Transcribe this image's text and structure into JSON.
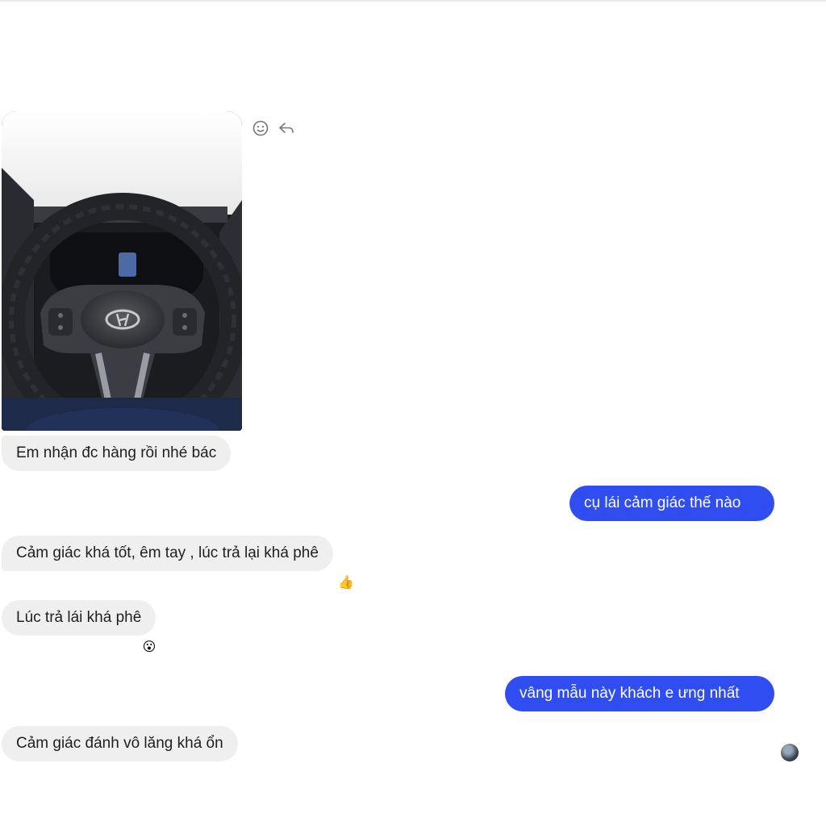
{
  "messages": [
    {
      "id": "m1",
      "sender": "contact",
      "text": "Em nhận đc hàng rồi nhé bác"
    },
    {
      "id": "m2",
      "sender": "me",
      "text": "cụ lái  cảm giác thế nào"
    },
    {
      "id": "m3",
      "sender": "contact",
      "text": "Cảm giác khá tốt, êm tay , lúc trả lại khá phê",
      "reaction": "👍"
    },
    {
      "id": "m4",
      "sender": "contact",
      "text": "Lúc trả lái khá phê",
      "reaction": "😮"
    },
    {
      "id": "m5",
      "sender": "me",
      "text": "vâng mẫu này khách e ưng nhất"
    },
    {
      "id": "m6",
      "sender": "contact",
      "text": "Cảm giác đánh vô lăng khá ổn"
    }
  ],
  "icons": {
    "react": "smiley-icon",
    "reply": "reply-icon"
  },
  "colors": {
    "outgoing_bubble": "#2f4df0",
    "incoming_bubble": "#efefef"
  }
}
